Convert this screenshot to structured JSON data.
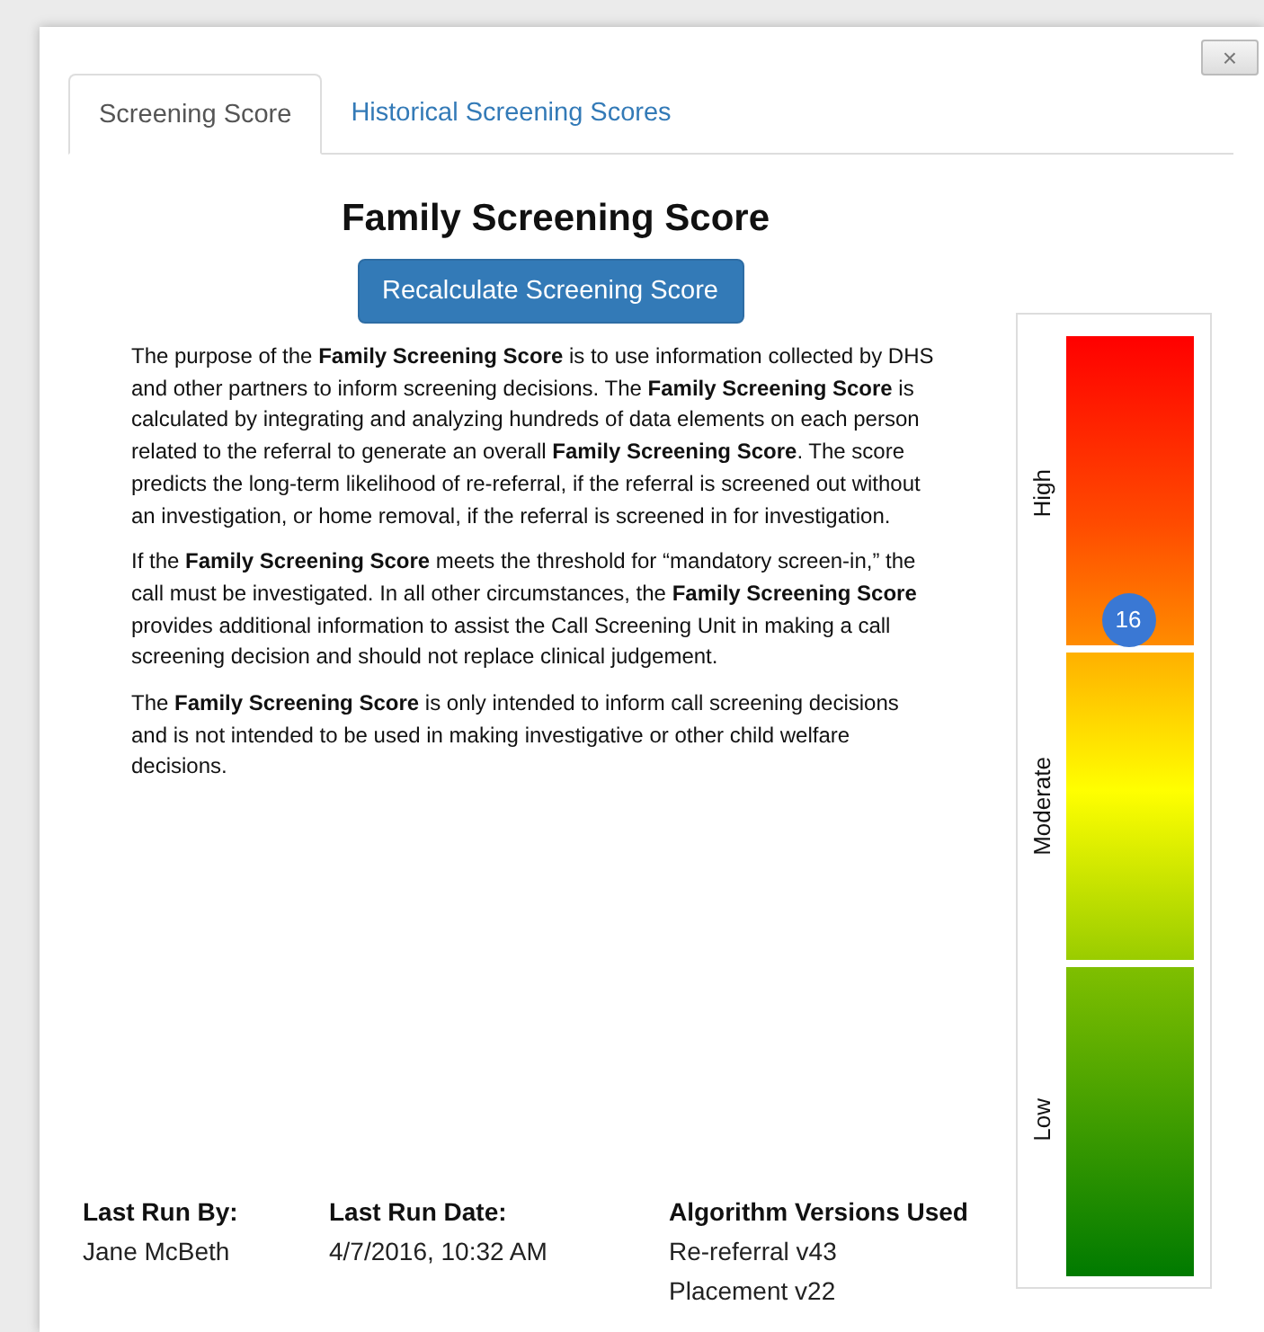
{
  "close_button": {
    "label": "×"
  },
  "tabs": [
    {
      "label": "Screening Score",
      "selected": true
    },
    {
      "label": "Historical Screening Scores",
      "selected": false
    }
  ],
  "heading": "Family Screening Score",
  "recalculate_button": {
    "label": "Recalculate Screening Score"
  },
  "paragraphs": [
    "The purpose of the **Family Screening Score** is to use information collected by DHS and other partners to inform screening decisions. The **Family Screening Score** is calculated by integrating and analyzing hundreds of data elements on each person related to the referral to generate an overall **Family Screening Score**.  The score predicts the long-term likelihood of re-referral, if the referral is screened out without an investigation, or home removal, if the referral is screened in for investigation.",
    "If the **Family Screening Score** meets the threshold for “mandatory screen-in,” the call must be investigated. In all other circumstances, the **Family Screening Score** provides additional information to assist the Call Screening Unit in making a call screening decision and should not replace clinical judgement.",
    "The **Family Screening Score** is only intended to inform call screening decisions and is not intended to be used in making investigative or other child welfare decisions."
  ],
  "footer": [
    {
      "label": "Last Run By:",
      "values": [
        "Jane McBeth"
      ]
    },
    {
      "label": "Last Run Date:",
      "values": [
        "4/7/2016, 10:32 AM"
      ]
    },
    {
      "label": "Algorithm Versions Used",
      "values": [
        "Re-referral v43",
        "Placement v22"
      ]
    }
  ],
  "scale": {
    "sections": [
      {
        "label": "High"
      },
      {
        "label": "Moderate"
      },
      {
        "label": "Low"
      }
    ],
    "marker": {
      "value": "16",
      "level": 0.7
    }
  }
}
